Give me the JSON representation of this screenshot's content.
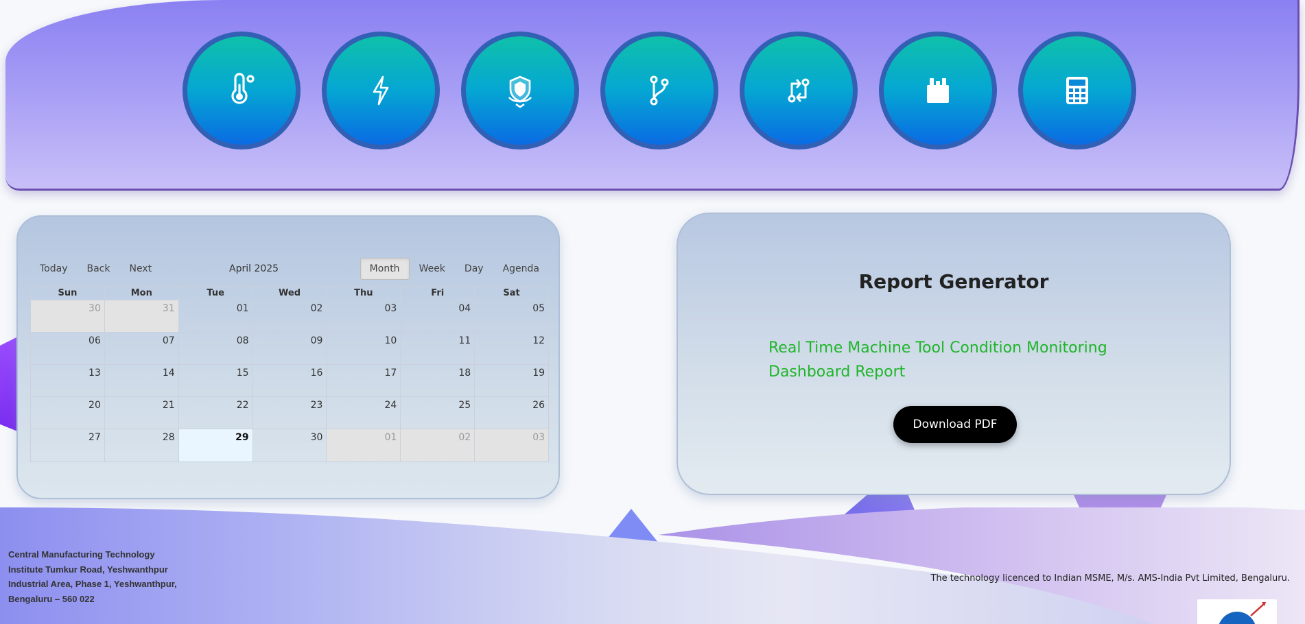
{
  "header": {
    "circles": [
      {
        "icon": "temperature-icon"
      },
      {
        "icon": "lightning-icon"
      },
      {
        "icon": "shield-icon"
      },
      {
        "icon": "git-branch-icon"
      },
      {
        "icon": "swap-arrows-icon"
      },
      {
        "icon": "plug-icon"
      },
      {
        "icon": "calculator-icon"
      }
    ]
  },
  "calendar": {
    "today_label": "Today",
    "back_label": "Back",
    "next_label": "Next",
    "month_label": "April 2025",
    "views": {
      "month": "Month",
      "week": "Week",
      "day": "Day",
      "agenda": "Agenda"
    },
    "active_view": "Month",
    "weekdays": [
      "Sun",
      "Mon",
      "Tue",
      "Wed",
      "Thu",
      "Fri",
      "Sat"
    ],
    "weeks": [
      [
        "30",
        "31",
        "01",
        "02",
        "03",
        "04",
        "05"
      ],
      [
        "06",
        "07",
        "08",
        "09",
        "10",
        "11",
        "12"
      ],
      [
        "13",
        "14",
        "15",
        "16",
        "17",
        "18",
        "19"
      ],
      [
        "20",
        "21",
        "22",
        "23",
        "24",
        "25",
        "26"
      ],
      [
        "27",
        "28",
        "29",
        "30",
        "01",
        "02",
        "03"
      ]
    ],
    "today_date": "29"
  },
  "report": {
    "title": "Report Generator",
    "subtitle": "Real Time Machine Tool Condition Monitoring Dashboard Report",
    "download_label": "Download PDF",
    "subtitle_color": "#1fb52a"
  },
  "footer": {
    "address_lines": [
      "Central Manufacturing Technology",
      "Institute Tumkur Road, Yeshwanthpur",
      "Industrial Area, Phase 1, Yeshwanthpur,",
      "Bengaluru – 560 022"
    ],
    "license": "The technology licenced to Indian MSME, M/s. AMS-India Pvt Limited, Bengaluru."
  },
  "colors": {
    "header_gradient_top": "#8b80f2",
    "circle_gradient_top": "#0fc1aa",
    "circle_gradient_bottom": "#0a6be3",
    "circle_border": "#3260b5"
  }
}
